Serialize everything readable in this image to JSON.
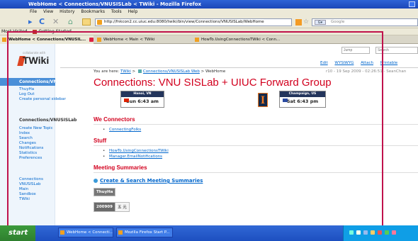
{
  "browser": {
    "title": "WebHome < Connections/VNUSISLab < TWiki - Mozilla Firefox",
    "menu": [
      "File",
      "View",
      "History",
      "Bookmarks",
      "Tools",
      "Help"
    ],
    "url": "http://fnkcon2.cc.uiuc.edu:8080/twiki/bin/view/Connections/VNUSISLab/WebHome",
    "search_placeholder": "Google",
    "bookmarks": [
      "Most Visited",
      "Getting Started"
    ],
    "tabs": [
      {
        "label": "WebHome < Connections/VNUSIL...",
        "active": true
      },
      {
        "label": "WebHome < Main < TWiki",
        "active": false
      },
      {
        "label": "HowTo.UsingConnectionsTWiki < Conn...",
        "active": false
      }
    ]
  },
  "sidebar": {
    "logo_tag": "collaborate with",
    "logo_text": "TWiki",
    "web_header": "Connections/VNUSISLab",
    "user_links": [
      "ThuyHa",
      "Log Out",
      "Create personal sidebar"
    ],
    "web_title": "Connections/VNUSISLab",
    "web_links": [
      "Create New Topic",
      "Index",
      "Search",
      "Changes",
      "Notifications",
      "Statistics",
      "Preferences"
    ],
    "webs_links": [
      "Connections",
      "VNUSISLab",
      "Main",
      "Sandbox",
      "TWiki"
    ]
  },
  "topbar": {
    "jump_placeholder": "Jump",
    "search_placeholder": "Search",
    "actions": [
      "Edit",
      "WYSIWYG",
      "Attach",
      "Printable"
    ]
  },
  "breadcrumb": {
    "prefix": "You are here:",
    "links": [
      "TWiki",
      "Connections/VNUSISLab Web",
      "WebHome"
    ],
    "revision": "r10 - 19 Sep 2009 - 02:26:51 - SeanChan"
  },
  "page": {
    "title": "Connections: VNU SISLab + UIUC Forward Group"
  },
  "clocks": [
    {
      "city": "Hanoi, VN",
      "time": "Sun 6:43 am"
    },
    {
      "city": "Champaign, US",
      "time": "Sat 6:43 pm"
    }
  ],
  "illinois_logo": "I",
  "sections": [
    {
      "heading": "We Connectors",
      "links": [
        "ConnectingFolks"
      ]
    },
    {
      "heading": "Stuff",
      "links": [
        "HowTo.UsingConnectionsTWiki",
        "Manager.EmailNotifications"
      ]
    },
    {
      "heading": "Meeting Summaries",
      "links": []
    }
  ],
  "meeting": {
    "create_link": "Create & Search Meeting Summaries",
    "table_header": "ThuyHa",
    "row_date": "200909",
    "row_value": "五 元"
  },
  "taskbar": {
    "start": "start",
    "items": [
      "WebHome < Connecti...",
      "Mozilla Firefox Start P..."
    ]
  }
}
